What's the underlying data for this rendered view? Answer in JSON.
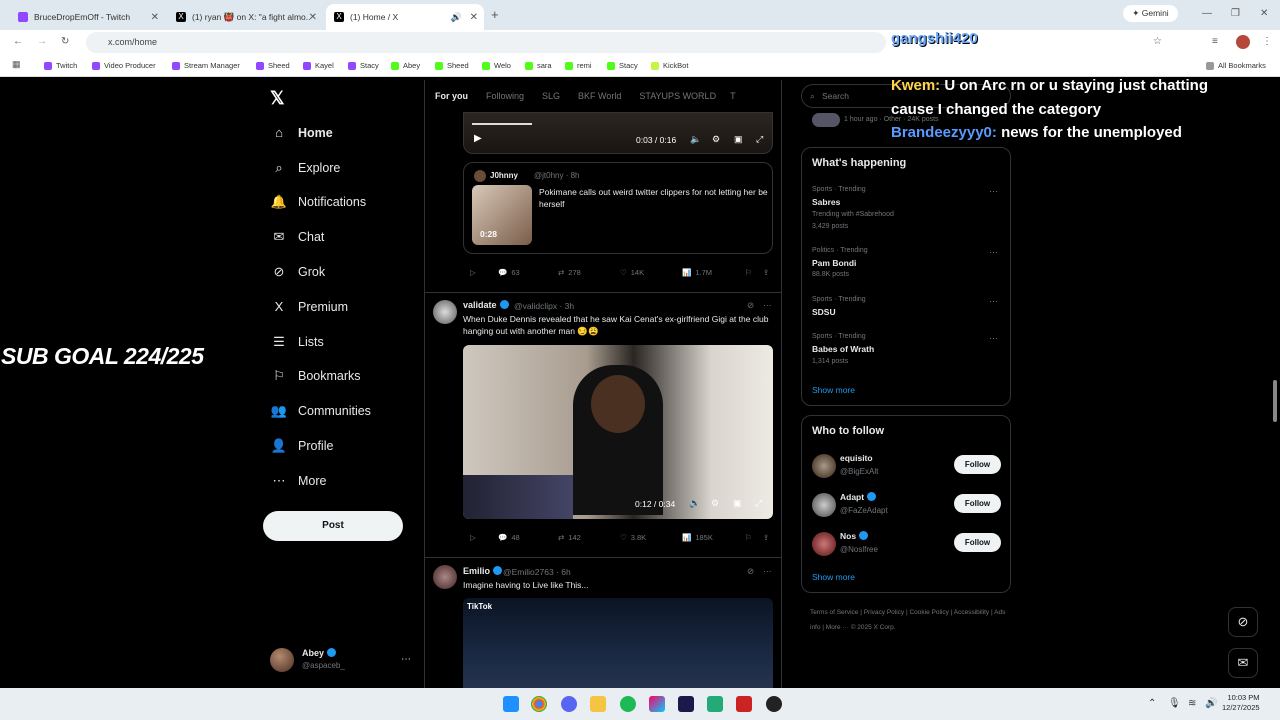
{
  "browser": {
    "tabs": [
      {
        "label": "BruceDropEmOff - Twitch"
      },
      {
        "label": "(1) ryan 👹 on X: \"a fight almo..."
      },
      {
        "label": "(1) Home / X"
      }
    ],
    "url": "x.com/home",
    "gemini_label": "Gemini",
    "new_tab": "+",
    "bookmarks": [
      "Twitch",
      "Video Producer",
      "Stream Manager",
      "Sheed",
      "Kayel",
      "Stacy",
      "Abey",
      "Sheed",
      "Welo",
      "sara",
      "remi",
      "Stacy",
      "KickBot"
    ],
    "all_bookmarks": "All Bookmarks"
  },
  "overlay": {
    "sub_goal": "SUB GOAL 224/225",
    "chat": [
      {
        "user": "gangshii420",
        "text": ""
      },
      {
        "user": "Kwem:",
        "text": "U on Arc rn or u staying just chatting"
      },
      {
        "user": "",
        "text": "cause I changed the category"
      },
      {
        "user": "Brandeezyyy0:",
        "text": "news for the unemployed"
      }
    ]
  },
  "nav": {
    "items": [
      {
        "label": "Home",
        "icon": "home-icon"
      },
      {
        "label": "Explore",
        "icon": "search-icon"
      },
      {
        "label": "Notifications",
        "icon": "bell-icon"
      },
      {
        "label": "Chat",
        "icon": "mail-icon"
      },
      {
        "label": "Grok",
        "icon": "grok-icon"
      },
      {
        "label": "Premium",
        "icon": "x-icon"
      },
      {
        "label": "Lists",
        "icon": "list-icon"
      },
      {
        "label": "Bookmarks",
        "icon": "bookmark-icon"
      },
      {
        "label": "Communities",
        "icon": "people-icon"
      },
      {
        "label": "Profile",
        "icon": "person-icon"
      },
      {
        "label": "More",
        "icon": "more-circle-icon"
      }
    ],
    "post_label": "Post",
    "profile": {
      "name": "Abey",
      "handle": "@aspaceb_"
    }
  },
  "feed": {
    "tabs": [
      "For you",
      "Following",
      "SLG",
      "BKF World",
      "STAYUPS WORLD",
      "T"
    ],
    "top_video_time": "0:03 / 0:16",
    "quote": {
      "name": "J0hnny",
      "handle": "@jt0hny · 8h",
      "text": "Pokimane calls out weird twitter clippers for not letting her be herself",
      "duration": "0:28"
    },
    "tweet1_actions": {
      "replies": "63",
      "reposts": "278",
      "likes": "14K",
      "views": "1.7M"
    },
    "tweet2": {
      "name": "validate",
      "handle": "@validclipx · 3h",
      "text": "When Duke Dennis revealed that he saw Kai Cenat's ex-girlfriend Gigi at the club hanging out with another man 😏😩",
      "video_time": "0:12 / 0:34",
      "actions": {
        "replies": "48",
        "reposts": "142",
        "likes": "3.8K",
        "views": "185K"
      }
    },
    "tweet3": {
      "name": "Emilio",
      "handle": "@Emilio2763 · 6h",
      "text": "Imagine having to Live like This...",
      "watermark": "TikTok"
    }
  },
  "right": {
    "search_placeholder": "Search",
    "live_meta": "1 hour ago · Other · 24K posts",
    "happening_title": "What's happening",
    "trends": [
      {
        "cat": "Sports · Trending",
        "name": "Sabres",
        "count": "Trending with #Sabrehood",
        "count2": "3,429 posts"
      },
      {
        "cat": "Politics · Trending",
        "name": "Pam Bondi",
        "count": "88.8K posts",
        "count2": ""
      },
      {
        "cat": "Sports · Trending",
        "name": "SDSU",
        "count": "",
        "count2": ""
      },
      {
        "cat": "Sports · Trending",
        "name": "Babes of Wrath",
        "count": "1,314 posts",
        "count2": ""
      }
    ],
    "show_more": "Show more",
    "follow_title": "Who to follow",
    "follow": [
      {
        "name": "equisito",
        "handle": "@BigExAlt"
      },
      {
        "name": "Adapt",
        "handle": "@FaZeAdapt"
      },
      {
        "name": "Nos",
        "handle": "@Noslfree"
      }
    ],
    "follow_label": "Follow",
    "footer": "Terms of Service  |  Privacy Policy  |  Cookie Policy  |  Accessibility  |  Ads info  |  More ···  © 2025 X Corp."
  },
  "taskbar": {
    "time": "10:03 PM",
    "date": "12/27/2025"
  }
}
